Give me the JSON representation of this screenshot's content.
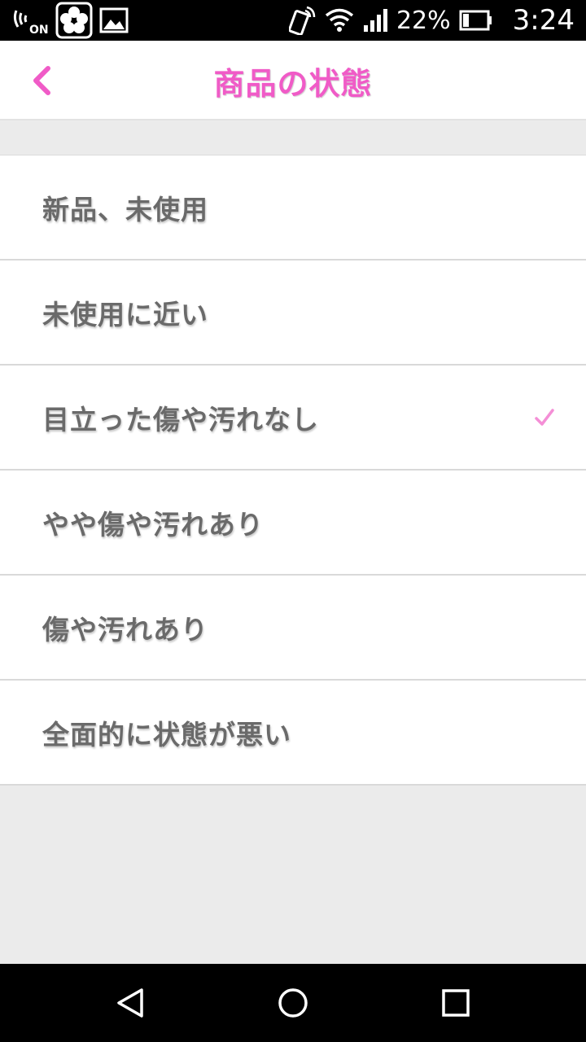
{
  "status_bar": {
    "battery_percent": "22%",
    "time": "3:24",
    "left_icons": [
      "nfc-on-icon",
      "flower-app-icon",
      "image-icon"
    ],
    "right_icons": [
      "tap-pay-icon",
      "wifi-icon",
      "signal-icon",
      "battery-icon"
    ],
    "nfc_on_label": "ON"
  },
  "header": {
    "title": "商品の状態",
    "back_icon": "chevron-left-icon",
    "accent_color": "#f05bc7"
  },
  "conditions": {
    "items": [
      {
        "label": "新品、未使用",
        "selected": false
      },
      {
        "label": "未使用に近い",
        "selected": false
      },
      {
        "label": "目立った傷や汚れなし",
        "selected": true
      },
      {
        "label": "やや傷や汚れあり",
        "selected": false
      },
      {
        "label": "傷や汚れあり",
        "selected": false
      },
      {
        "label": "全面的に状態が悪い",
        "selected": false
      }
    ],
    "check_icon": "checkmark-icon"
  },
  "nav_bar": {
    "buttons": [
      "back-triangle-icon",
      "home-circle-icon",
      "recents-square-icon"
    ]
  }
}
